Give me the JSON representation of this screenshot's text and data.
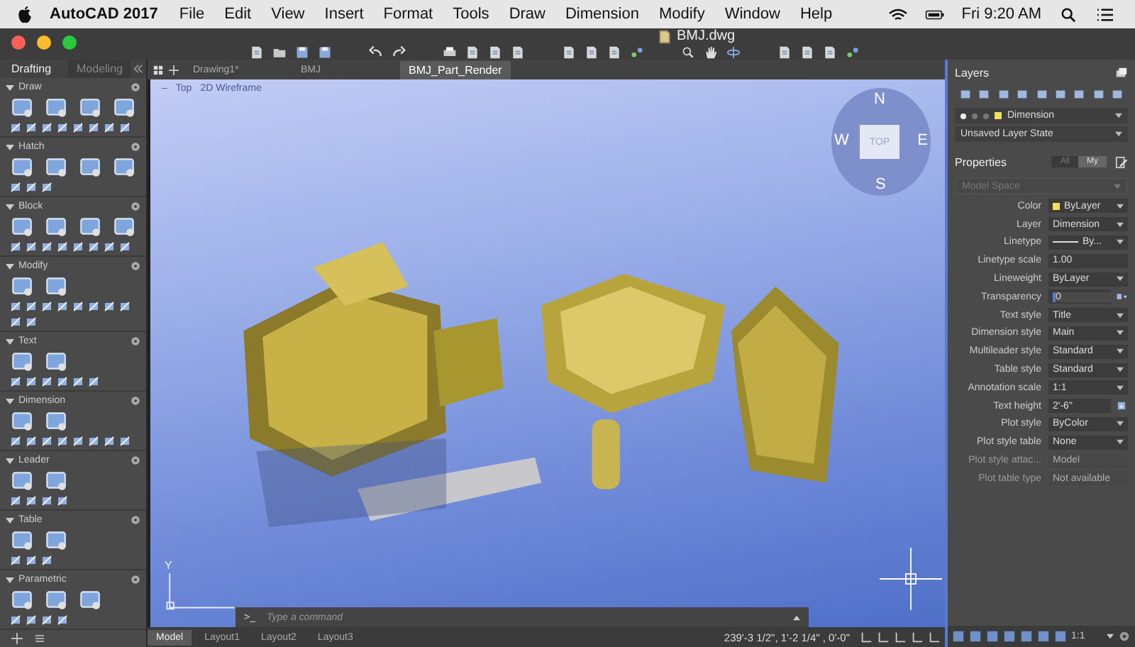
{
  "menubar": {
    "app": "AutoCAD 2017",
    "items": [
      "File",
      "Edit",
      "View",
      "Insert",
      "Format",
      "Tools",
      "Draw",
      "Dimension",
      "Modify",
      "Window",
      "Help"
    ],
    "clock": "Fri 9:20 AM"
  },
  "window": {
    "title": "BMJ.dwg"
  },
  "workspace_tabs": [
    {
      "label": "Drafting",
      "selected": true
    },
    {
      "label": "Modeling",
      "selected": false
    }
  ],
  "palette_sections": [
    {
      "label": "Draw",
      "expanded": true
    },
    {
      "label": "Hatch",
      "expanded": true
    },
    {
      "label": "Block",
      "expanded": true
    },
    {
      "label": "Modify",
      "expanded": true
    },
    {
      "label": "Text",
      "expanded": true
    },
    {
      "label": "Dimension",
      "expanded": true
    },
    {
      "label": "Leader",
      "expanded": true
    },
    {
      "label": "Table",
      "expanded": true
    },
    {
      "label": "Parametric",
      "expanded": true
    }
  ],
  "document_tabs": [
    {
      "label": "Drawing1*",
      "selected": false
    },
    {
      "label": "BMJ",
      "selected": false
    },
    {
      "label": "BMJ_Part_Render",
      "selected": true
    }
  ],
  "viewport": {
    "controls": [
      "–",
      "Top",
      "2D Wireframe"
    ],
    "viewcube": {
      "north": "N",
      "west": "W",
      "east": "E",
      "south": "S",
      "face": "TOP"
    },
    "ucs_label": "Y"
  },
  "command_line": {
    "prompt": ">_",
    "placeholder": "Type a command"
  },
  "layout_tabs": [
    {
      "label": "Model",
      "selected": true
    },
    {
      "label": "Layout1",
      "selected": false
    },
    {
      "label": "Layout2",
      "selected": false
    },
    {
      "label": "Layout3",
      "selected": false
    }
  ],
  "status_bar": {
    "coordinates": "239'-3 1/2\",  1'-2 1/4\" , 0'-0\"",
    "annotation_scale": "1:1"
  },
  "layers": {
    "title": "Layers",
    "current_layer": "Dimension",
    "layer_state": "Unsaved Layer State"
  },
  "properties": {
    "title": "Properties",
    "filters": [
      {
        "label": "All",
        "selected": false
      },
      {
        "label": "My",
        "selected": true
      }
    ],
    "space": "Model Space",
    "rows": [
      {
        "label": "Color",
        "value": "ByLayer",
        "kind": "color",
        "color": "#f0e060"
      },
      {
        "label": "Layer",
        "value": "Dimension",
        "kind": "select"
      },
      {
        "label": "Linetype",
        "value": "By...",
        "kind": "linetype"
      },
      {
        "label": "Linetype scale",
        "value": "1.00",
        "kind": "text"
      },
      {
        "label": "Lineweight",
        "value": "ByLayer",
        "kind": "select"
      },
      {
        "label": "Transparency",
        "value": "0",
        "kind": "transparency"
      },
      {
        "label": "Text style",
        "value": "Title",
        "kind": "select"
      },
      {
        "label": "Dimension style",
        "value": "Main",
        "kind": "select"
      },
      {
        "label": "Multileader style",
        "value": "Standard",
        "kind": "select"
      },
      {
        "label": "Table style",
        "value": "Standard",
        "kind": "select"
      },
      {
        "label": "Annotation scale",
        "value": "1:1",
        "kind": "select"
      },
      {
        "label": "Text height",
        "value": "2'-6\"",
        "kind": "height"
      },
      {
        "label": "Plot style",
        "value": "ByColor",
        "kind": "select"
      },
      {
        "label": "Plot style table",
        "value": "None",
        "kind": "select"
      },
      {
        "label": "Plot style attac...",
        "value": "Model",
        "kind": "readonly"
      },
      {
        "label": "Plot table type",
        "value": "Not available",
        "kind": "readonly"
      }
    ]
  }
}
